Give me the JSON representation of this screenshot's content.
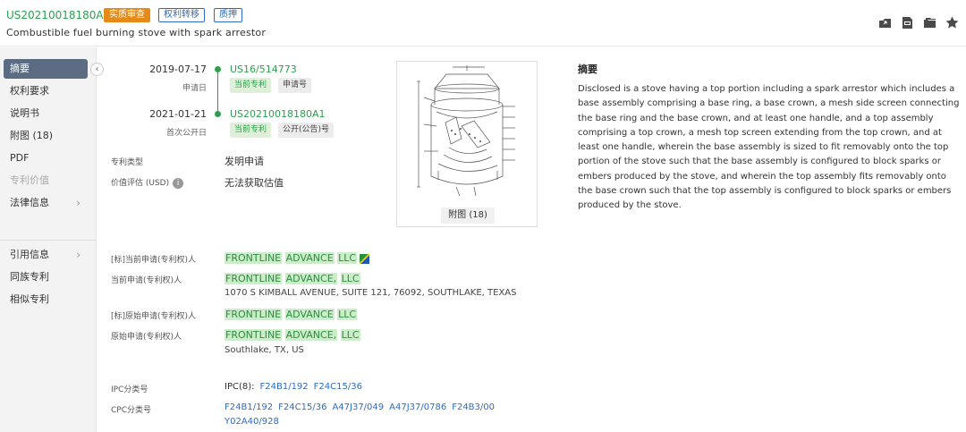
{
  "header": {
    "pub_number": "US20210018180A1",
    "badges": [
      "实质审查",
      "权利转移",
      "质押"
    ],
    "title": "Combustible fuel burning stove with spark arrestor",
    "icons": [
      "share-icon",
      "pdf-icon",
      "folder-icon",
      "star-icon"
    ]
  },
  "sidebar": {
    "items": [
      {
        "label": "摘要"
      },
      {
        "label": "权利要求"
      },
      {
        "label": "说明书"
      },
      {
        "label": "附图 (18)"
      },
      {
        "label": "PDF"
      },
      {
        "label": "专利价值"
      },
      {
        "label": "法律信息"
      },
      {
        "label": "引用信息"
      },
      {
        "label": "同族专利"
      },
      {
        "label": "相似专利"
      }
    ],
    "collapse_glyph": "‹"
  },
  "timeline": {
    "events": [
      {
        "date": "2019-07-17",
        "sub": "申请日",
        "link": "US16/514773",
        "tags": [
          "当前专利",
          "申请号"
        ]
      },
      {
        "date": "2021-01-21",
        "sub": "首次公开日",
        "link": "US20210018180A1",
        "tags": [
          "当前专利",
          "公开(公告)号"
        ]
      }
    ]
  },
  "info": {
    "type_label": "专利类型",
    "type_value": "发明申请",
    "value_label": "价值评估 (USD)",
    "value_value": "无法获取估值"
  },
  "figure": {
    "caption": "附图 (18)"
  },
  "abstract": {
    "title": "摘要",
    "text": "Disclosed is a stove having a top portion including a spark arrestor which includes a base assembly comprising a base ring, a base crown, a mesh side screen connecting the base ring and the base crown, and at least one handle, and a top assembly comprising a top crown, a mesh top screen extending from the top crown, and at least one handle, wherein the base assembly is sized to fit removably onto the top portion of the stove such that the base assembly is configured to block sparks or embers produced by the stove, and wherein the top assembly fits removably onto the base crown such that the top assembly is configured to block sparks or embers produced by the stove."
  },
  "applicants": {
    "std_current_label": "[标]当前申请(专利权)人",
    "std_current_words": [
      "FRONTLINE",
      "ADVANCE",
      "LLC"
    ],
    "current_label": "当前申请(专利权)人",
    "current_words": [
      "FRONTLINE",
      "ADVANCE,",
      "LLC"
    ],
    "current_addr": "1070 S KIMBALL AVENUE, SUITE 121, 76092, SOUTHLAKE, TEXAS",
    "std_orig_label": "[标]原始申请(专利权)人",
    "std_orig_words": [
      "FRONTLINE",
      "ADVANCE",
      "LLC"
    ],
    "orig_label": "原始申请(专利权)人",
    "orig_words": [
      "FRONTLINE",
      "ADVANCE,",
      "LLC"
    ],
    "orig_addr": "Southlake, TX, US"
  },
  "classification": {
    "ipc_label": "IPC分类号",
    "ipc_prefix": "IPC(8):",
    "ipc_codes": [
      "F24B1/192",
      "F24C15/36"
    ],
    "cpc_label": "CPC分类号",
    "cpc_codes_line1": [
      "F24B1/192",
      "F24C15/36",
      "A47J37/049",
      "A47J37/0786",
      "F24B3/00"
    ],
    "cpc_codes_line2": [
      "Y02A40/928"
    ]
  },
  "colors": {
    "accent_green": "#2e9e4f",
    "link_blue": "#2b6cc4",
    "badge_orange": "#e58a18",
    "sidebar_active": "#5a6b82"
  }
}
